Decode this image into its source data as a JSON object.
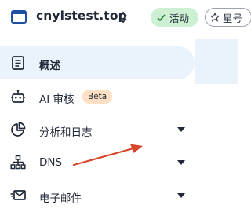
{
  "header": {
    "site_name": "cnylstest.top",
    "status_label": "活动",
    "star_label": "星号"
  },
  "sidebar": {
    "items": [
      {
        "label": "概述",
        "icon": "document-icon",
        "active": true
      },
      {
        "label": "AI 审核",
        "icon": "robot-icon",
        "badge": "Beta"
      },
      {
        "label": "分析和日志",
        "icon": "pie-chart-icon",
        "has_caret": true
      },
      {
        "label": "DNS",
        "icon": "network-icon",
        "has_caret": true
      },
      {
        "label": "电子邮件",
        "icon": "email-icon",
        "has_caret": true
      }
    ]
  },
  "colors": {
    "brand": "#1f4fa0",
    "active_bg": "#eaf3fb",
    "status_green": "#cdefd2",
    "beta_orange": "#fde0c4",
    "annotation_arrow": "#d9452b"
  }
}
